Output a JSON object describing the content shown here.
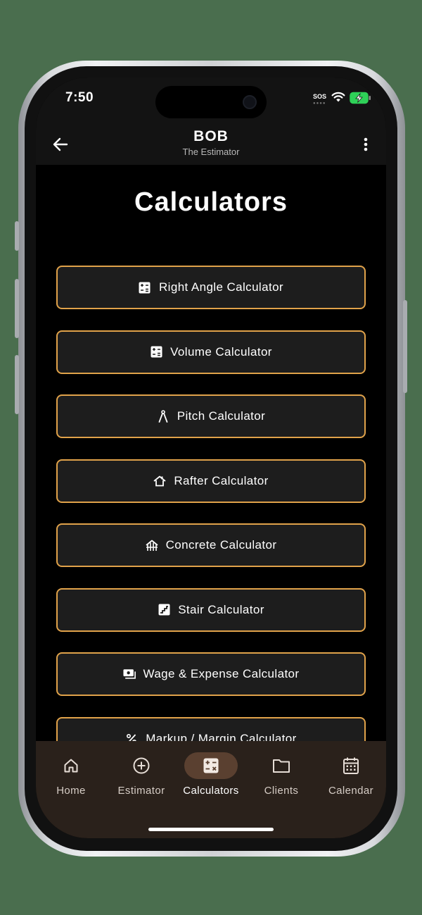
{
  "status_bar": {
    "time": "7:50",
    "sos": "SOS"
  },
  "app_bar": {
    "title": "BOB",
    "subtitle": "The Estimator"
  },
  "page": {
    "title": "Calculators"
  },
  "calculators": [
    {
      "label": "Right Angle Calculator",
      "icon": "calculator-icon"
    },
    {
      "label": "Volume Calculator",
      "icon": "calculator-icon"
    },
    {
      "label": "Pitch Calculator",
      "icon": "compass-icon"
    },
    {
      "label": "Rafter Calculator",
      "icon": "roof-icon"
    },
    {
      "label": "Concrete Calculator",
      "icon": "foundation-icon"
    },
    {
      "label": "Stair Calculator",
      "icon": "stairs-icon"
    },
    {
      "label": "Wage & Expense Calculator",
      "icon": "payments-icon"
    },
    {
      "label": "Markup / Margin Calculator",
      "icon": "percent-icon"
    }
  ],
  "bottom_nav": {
    "active": "Calculators",
    "items": [
      {
        "label": "Home",
        "icon": "home-icon"
      },
      {
        "label": "Estimator",
        "icon": "add-circle-icon"
      },
      {
        "label": "Calculators",
        "icon": "calculator-icon"
      },
      {
        "label": "Clients",
        "icon": "folder-icon"
      },
      {
        "label": "Calendar",
        "icon": "calendar-icon"
      }
    ]
  },
  "colors": {
    "accent_border": "#e0a24a",
    "nav_bg": "#2a211b",
    "active_pill": "#5a4030"
  }
}
